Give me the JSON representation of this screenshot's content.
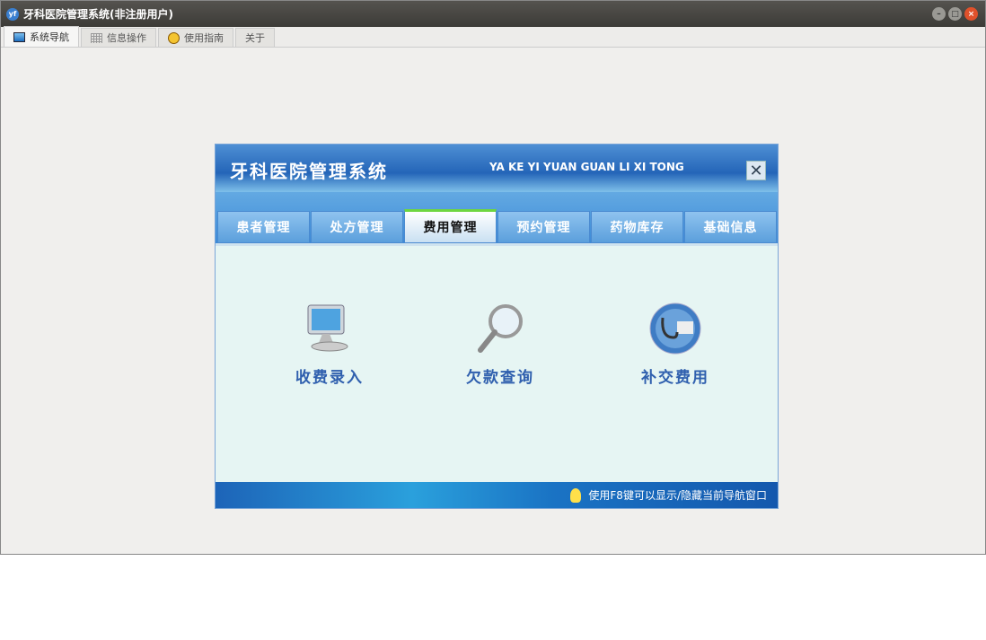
{
  "window": {
    "title": "牙科医院管理系统(非注册用户)"
  },
  "tabs": [
    {
      "label": "系统导航"
    },
    {
      "label": "信息操作"
    },
    {
      "label": "使用指南"
    },
    {
      "label": "关于"
    }
  ],
  "panel": {
    "title": "牙科医院管理系统",
    "subtitle": "YA KE YI YUAN GUAN LI XI TONG",
    "close": "✕",
    "nav_tabs": [
      {
        "label": "患者管理"
      },
      {
        "label": "处方管理"
      },
      {
        "label": "费用管理"
      },
      {
        "label": "预约管理"
      },
      {
        "label": "药物库存"
      },
      {
        "label": "基础信息"
      }
    ],
    "items": [
      {
        "label": "收费录入"
      },
      {
        "label": "欠款查询"
      },
      {
        "label": "补交费用"
      }
    ],
    "footer": "使用F8键可以显示/隐藏当前导航窗口"
  }
}
